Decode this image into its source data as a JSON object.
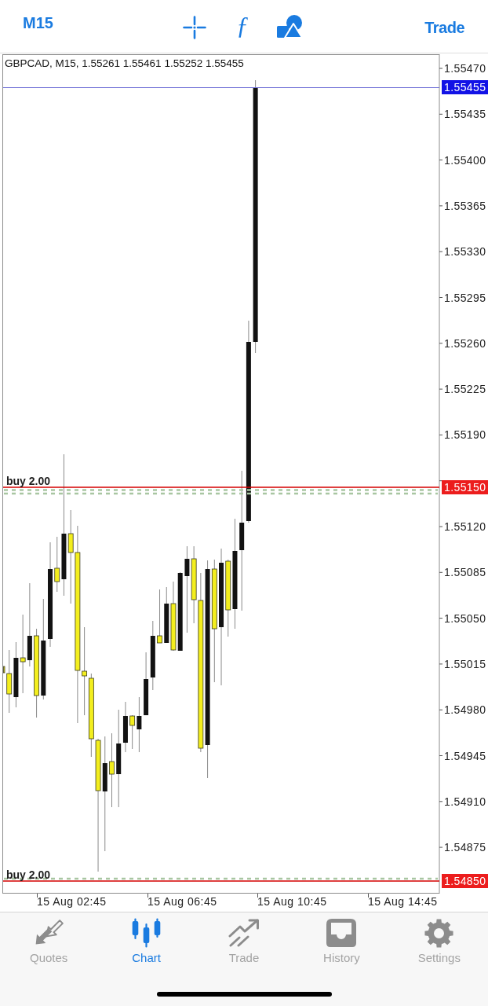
{
  "toolbar": {
    "timeframe": "M15",
    "function_glyph": "ƒ",
    "trade": "Trade"
  },
  "chart": {
    "title": "GBPCAD, M15, 1.55261 1.55461 1.55252 1.55455",
    "price_axis": [
      "1.55470",
      "1.55435",
      "1.55400",
      "1.55365",
      "1.55330",
      "1.55295",
      "1.55260",
      "1.55225",
      "1.55190",
      "1.55120",
      "1.55085",
      "1.55050",
      "1.55015",
      "1.54980",
      "1.54945",
      "1.54910",
      "1.54875"
    ],
    "price_lines": [
      {
        "kind": "bid",
        "price": "1.55455"
      },
      {
        "kind": "order",
        "price": "1.55150",
        "label": "buy 2.00"
      },
      {
        "kind": "order",
        "price": "1.54850",
        "label": "buy 2.00"
      }
    ],
    "time_axis": [
      "15 Aug 02:45",
      "15 Aug 06:45",
      "15 Aug 10:45",
      "15 Aug 14:45"
    ]
  },
  "tab_bar": {
    "tabs": [
      {
        "label": "Quotes",
        "selected": false
      },
      {
        "label": "Chart",
        "selected": true
      },
      {
        "label": "Trade",
        "selected": false
      },
      {
        "label": "History",
        "selected": false
      },
      {
        "label": "Settings",
        "selected": false
      }
    ]
  }
}
